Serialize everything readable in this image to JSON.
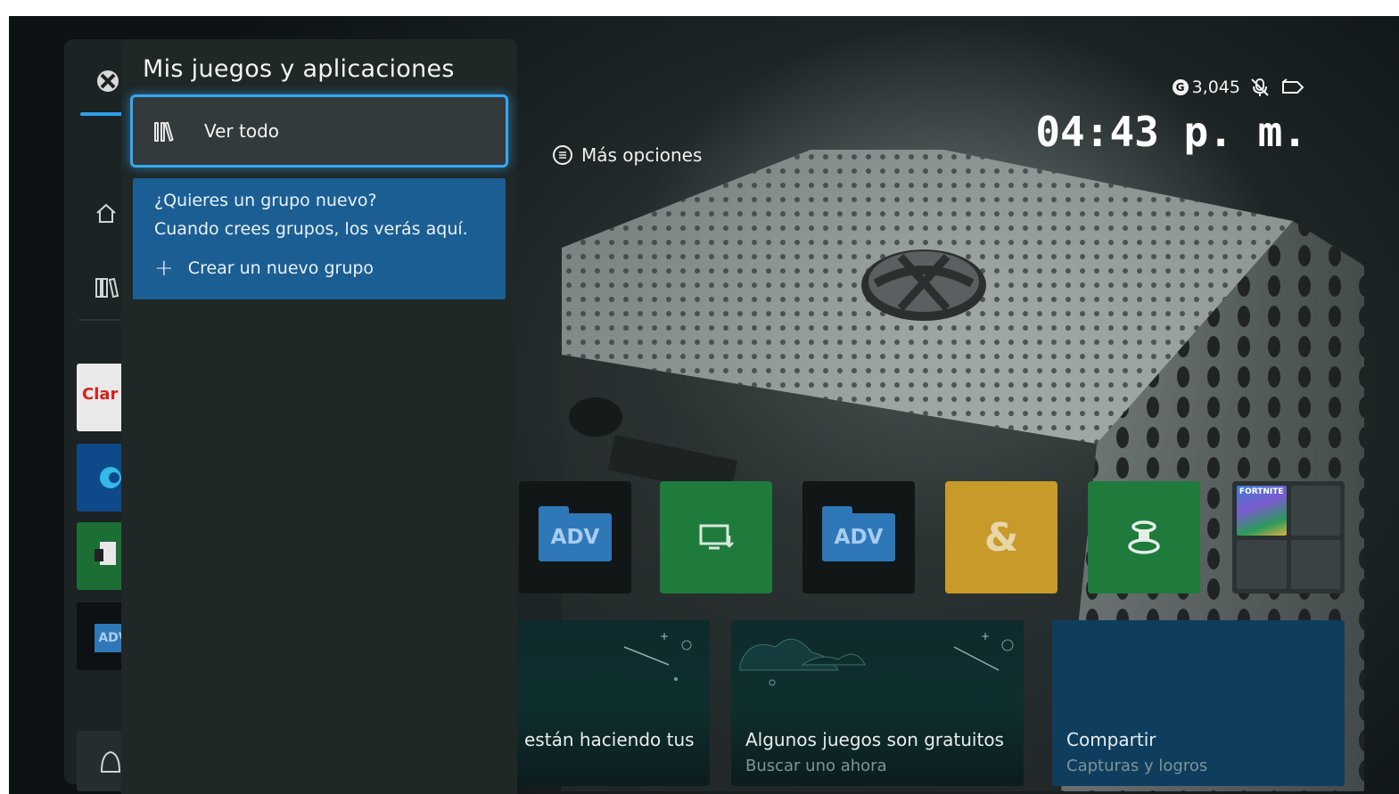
{
  "status": {
    "gamerscore": "3,045",
    "icons": [
      "gamerscore-icon",
      "mic-muted-icon",
      "battery-icon"
    ],
    "time": "04:43 p. m."
  },
  "more_options": {
    "label": "Más opciones",
    "icon": "menu-icon"
  },
  "panel": {
    "title": "Mis juegos y aplicaciones",
    "view_all": {
      "label": "Ver todo",
      "icon": "library-icon"
    },
    "group_prompt": {
      "question": "¿Quieres un grupo nuevo?",
      "description": "Cuando crees grupos, los verás aquí.",
      "create_label": "Crear un nuevo grupo",
      "create_icon": "plus-icon"
    }
  },
  "rail": {
    "items": [
      {
        "name": "xbox-logo-icon"
      },
      {
        "name": "home-icon"
      },
      {
        "name": "library-icon"
      },
      {
        "name": "claro-video-app",
        "label": "Clar"
      },
      {
        "name": "edge-app"
      },
      {
        "name": "store-app"
      },
      {
        "name": "adv-app",
        "label": "ADV"
      },
      {
        "name": "notifications-bell-icon"
      }
    ]
  },
  "tiles": [
    {
      "type": "adv",
      "label": "ADV"
    },
    {
      "type": "green",
      "icon": "device-icon"
    },
    {
      "type": "adv",
      "label": "ADV"
    },
    {
      "type": "gold",
      "icon": "ampersand-icon",
      "label": "&"
    },
    {
      "type": "green",
      "icon": "stack-icon"
    },
    {
      "type": "group",
      "first_label": "FORTNITE"
    }
  ],
  "cards": [
    {
      "title": "están haciendo tus",
      "subtitle": ""
    },
    {
      "title": "Algunos juegos son gratuitos",
      "subtitle": "Buscar uno ahora"
    },
    {
      "title": "Compartir",
      "subtitle": "Capturas y logros"
    }
  ],
  "colors": {
    "accent_focus": "#36a9f3",
    "group_box": "#1b5e93",
    "tile_green": "#1f7b3c",
    "tile_gold": "#c79a2a",
    "share_card": "#0e3d5e"
  }
}
